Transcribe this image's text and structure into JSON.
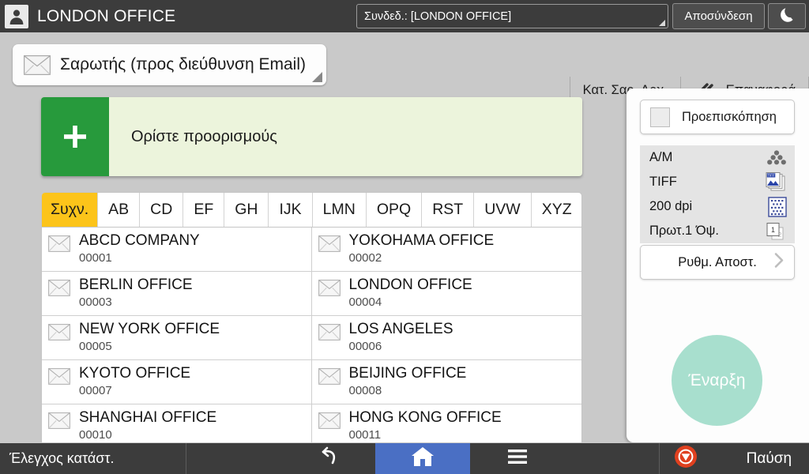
{
  "topbar": {
    "user_icon": "person-icon",
    "user_name": "LONDON OFFICE",
    "login_status": "Συνδεδ.: [LONDON OFFICE]",
    "logout_label": "Αποσύνδεση",
    "sleep_icon": "moon-icon"
  },
  "appbar": {
    "mode_icon": "envelope-icon",
    "mode_label": "Σαρωτής (προς διεύθυνση Email)",
    "scan_settings_label": "Κατ. Σαρ. Αρχ.",
    "reset_icon": "reset-icon",
    "reset_label": "Επαναφορά"
  },
  "destination": {
    "plus_icon": "plus-icon",
    "label": "Ορίστε προορισμούς"
  },
  "tabs": {
    "items": [
      {
        "label": "Συχν.",
        "active": true
      },
      {
        "label": "AB",
        "active": false
      },
      {
        "label": "CD",
        "active": false
      },
      {
        "label": "EF",
        "active": false
      },
      {
        "label": "GH",
        "active": false
      },
      {
        "label": "IJK",
        "active": false
      },
      {
        "label": "LMN",
        "active": false
      },
      {
        "label": "OPQ",
        "active": false
      },
      {
        "label": "RST",
        "active": false
      },
      {
        "label": "UVW",
        "active": false
      },
      {
        "label": "XYZ",
        "active": false
      }
    ],
    "sort_icon": "sort-toggle-icon"
  },
  "address_list": {
    "entry_icon": "envelope-icon",
    "entries": [
      {
        "name": "ABCD COMPANY",
        "number": "00001"
      },
      {
        "name": "YOKOHAMA OFFICE",
        "number": "00002"
      },
      {
        "name": "BERLIN OFFICE",
        "number": "00003"
      },
      {
        "name": "LONDON OFFICE",
        "number": "00004"
      },
      {
        "name": "NEW YORK OFFICE",
        "number": "00005"
      },
      {
        "name": "LOS ANGELES",
        "number": "00006"
      },
      {
        "name": "KYOTO OFFICE",
        "number": "00007"
      },
      {
        "name": "BEIJING OFFICE",
        "number": "00008"
      },
      {
        "name": "SHANGHAI  OFFICE",
        "number": "00010"
      },
      {
        "name": "HONG KONG OFFICE",
        "number": "00011"
      }
    ]
  },
  "right_panel": {
    "preview_label": "Προεπισκόπηση",
    "preview_checkbox_icon": "checkbox-unchecked-icon",
    "settings": [
      {
        "label": "A/M",
        "icon": "halftone-dots-icon"
      },
      {
        "label": "TIFF",
        "icon": "tiff-file-icon"
      },
      {
        "label": "200 dpi",
        "icon": "resolution-grid-icon"
      },
      {
        "label": "Πρωτ.1 Όψ.",
        "icon": "one-sided-original-icon"
      }
    ],
    "send_settings_label": "Ρυθμ. Αποστ.",
    "send_settings_chevron": "chevron-right-icon",
    "start_label": "Έναρξη",
    "start_color": "#a8dfce"
  },
  "bottombar": {
    "status_label": "Έλεγχος κατάστ.",
    "back_icon": "back-arrow-icon",
    "home_icon": "home-icon",
    "menu_icon": "hamburger-menu-icon",
    "stop_icon": "stop-icon",
    "pause_label": "Παύση",
    "home_accent": "#4a6fc4",
    "stop_accent": "#e0401f"
  }
}
